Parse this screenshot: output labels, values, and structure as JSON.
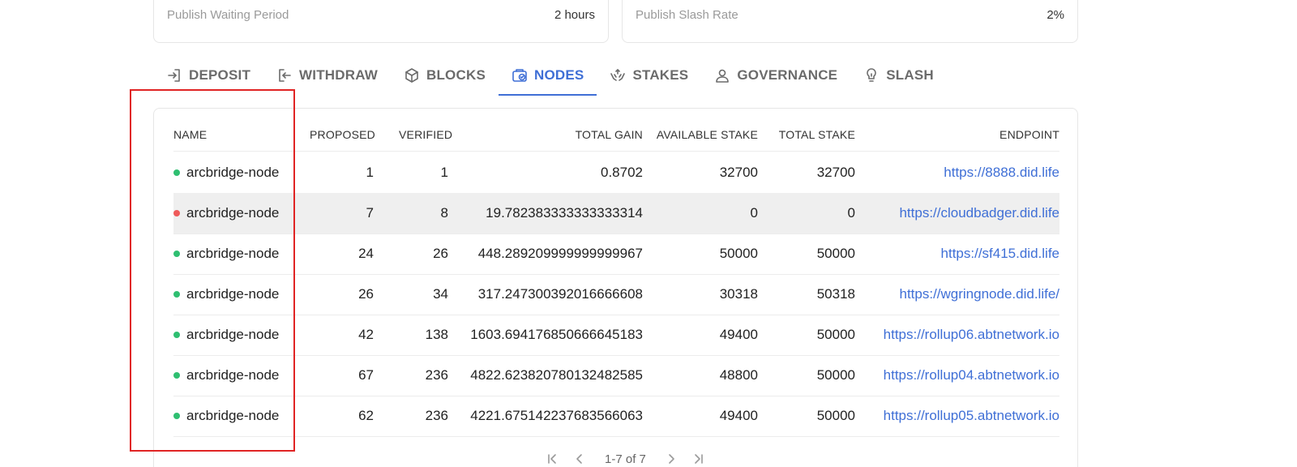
{
  "stats": {
    "waiting": {
      "label": "Publish Waiting Period",
      "value": "2 hours"
    },
    "slash_rate": {
      "label": "Publish Slash Rate",
      "value": "2%"
    }
  },
  "tabs": [
    {
      "label": "DEPOSIT",
      "icon": "deposit-icon"
    },
    {
      "label": "WITHDRAW",
      "icon": "withdraw-icon"
    },
    {
      "label": "BLOCKS",
      "icon": "cube-icon"
    },
    {
      "label": "NODES",
      "icon": "nodes-icon",
      "active": true
    },
    {
      "label": "STAKES",
      "icon": "hands-icon"
    },
    {
      "label": "GOVERNANCE",
      "icon": "user-icon"
    },
    {
      "label": "SLASH",
      "icon": "lightbulb-icon"
    }
  ],
  "table": {
    "headers": {
      "name": "NAME",
      "proposed": "PROPOSED",
      "verified": "VERIFIED",
      "total_gain": "TOTAL GAIN",
      "available_stake": "AVAILABLE STAKE",
      "total_stake": "TOTAL STAKE",
      "endpoint": "ENDPOINT"
    },
    "rows": [
      {
        "name": "arcbridge-node",
        "status_color": "#2fbf71",
        "proposed": "1",
        "verified": "1",
        "total_gain": "0.8702",
        "available_stake": "32700",
        "total_stake": "32700",
        "endpoint": "https://8888.did.life"
      },
      {
        "name": "arcbridge-node",
        "status_color": "#ef5b5b",
        "proposed": "7",
        "verified": "8",
        "total_gain": "19.782383333333333314",
        "available_stake": "0",
        "total_stake": "0",
        "endpoint": "https://cloudbadger.did.life"
      },
      {
        "name": "arcbridge-node",
        "status_color": "#2fbf71",
        "proposed": "24",
        "verified": "26",
        "total_gain": "448.289209999999999967",
        "available_stake": "50000",
        "total_stake": "50000",
        "endpoint": "https://sf415.did.life"
      },
      {
        "name": "arcbridge-node",
        "status_color": "#2fbf71",
        "proposed": "26",
        "verified": "34",
        "total_gain": "317.247300392016666608",
        "available_stake": "30318",
        "total_stake": "50318",
        "endpoint": "https://wgringnode.did.life/"
      },
      {
        "name": "arcbridge-node",
        "status_color": "#2fbf71",
        "proposed": "42",
        "verified": "138",
        "total_gain": "1603.694176850666645183",
        "available_stake": "49400",
        "total_stake": "50000",
        "endpoint": "https://rollup06.abtnetwork.io"
      },
      {
        "name": "arcbridge-node",
        "status_color": "#2fbf71",
        "proposed": "67",
        "verified": "236",
        "total_gain": "4822.623820780132482585",
        "available_stake": "48800",
        "total_stake": "50000",
        "endpoint": "https://rollup04.abtnetwork.io"
      },
      {
        "name": "arcbridge-node",
        "status_color": "#2fbf71",
        "proposed": "62",
        "verified": "236",
        "total_gain": "4221.675142237683566063",
        "available_stake": "49400",
        "total_stake": "50000",
        "endpoint": "https://rollup05.abtnetwork.io"
      }
    ]
  },
  "pagination": {
    "range": "1-7 of 7"
  },
  "colors": {
    "accent": "#3f6fd6",
    "highlight": "#e02424"
  }
}
